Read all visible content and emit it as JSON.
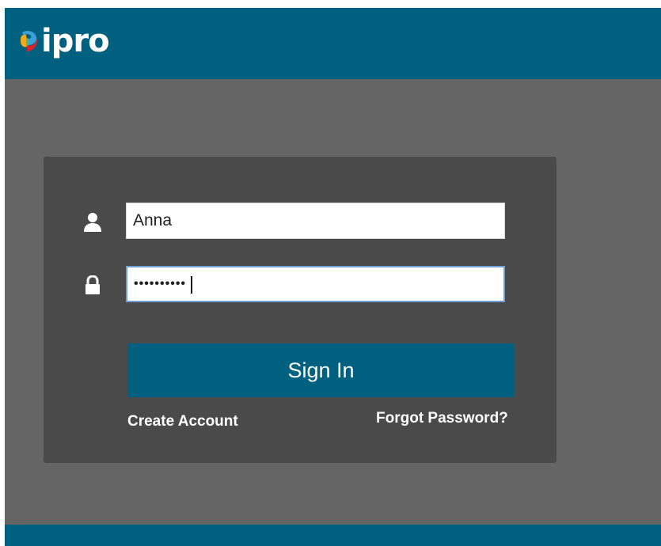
{
  "header": {
    "logo_text": "ipro",
    "logo_icon": "ipro-logo-icon",
    "brand_color": "#00607f"
  },
  "login": {
    "username": {
      "icon": "user-icon",
      "value": "Anna"
    },
    "password": {
      "icon": "lock-icon",
      "value": "••••••••••",
      "focused": true
    },
    "sign_in_label": "Sign In",
    "create_account_label": "Create Account",
    "forgot_password_label": "Forgot Password?"
  },
  "colors": {
    "background": "#656565",
    "panel": "#4a4a4a",
    "accent": "#00607f",
    "focus_border": "#6e9fd6"
  }
}
